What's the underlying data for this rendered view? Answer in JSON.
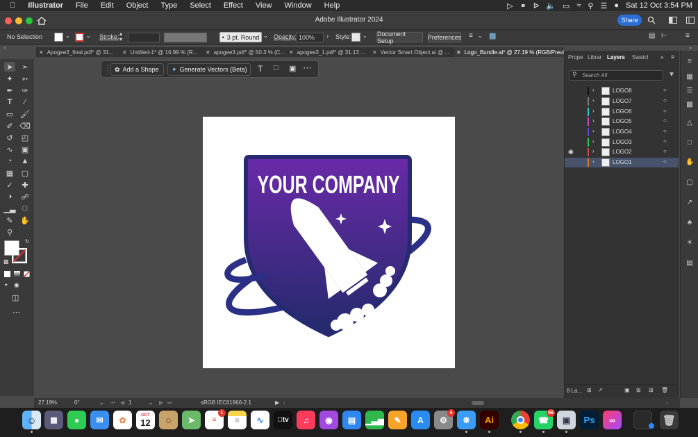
{
  "menubar": {
    "app_name": "Illustrator",
    "items": [
      "File",
      "Edit",
      "Object",
      "Type",
      "Select",
      "Effect",
      "View",
      "Window",
      "Help"
    ],
    "datetime": "Sat 12 Oct  3:54 PM"
  },
  "titlebar": {
    "title": "Adobe Illustrator 2024",
    "share_label": "Share"
  },
  "control_bar": {
    "selection": "No Selection",
    "stroke_label": "Stroke:",
    "brush": "3 pt. Round",
    "opacity_label": "Opacity:",
    "opacity_value": "100%",
    "style_label": "Style:",
    "document_setup": "Document Setup",
    "preferences": "Preferences"
  },
  "tabs": [
    "Apogee3_final.pdf* @ 31...",
    "Untitled-1* @ 16.99 % (R...",
    "apogee3.pdf* @ 50.3 % (C...",
    "apogee3_1.pdf* @ 31.13 ...",
    "Vector Smart Object.ai @ ...",
    "Logo_Bundle.ai* @ 27.19 % (RGB/Previe"
  ],
  "context_bar": {
    "add_shape": "Add a Shape",
    "generate_vectors": "Generate Vectors (Beta)"
  },
  "logo": {
    "text": "YOUR COMPANY",
    "color_top": "#6a2aa8",
    "color_bottom": "#232a6b",
    "ring_color": "#2b2f86"
  },
  "panel": {
    "tabs": [
      "Prope",
      "Librar",
      "Layers",
      "Swatcl"
    ],
    "search_placeholder": "Search All",
    "layers": [
      "LOGO8",
      "LOGO7",
      "LOGO6",
      "LOGO5",
      "LOGO4",
      "LOGO3",
      "LOGO2",
      "LOGO1"
    ],
    "layer_colors": [
      "#111111",
      "#7a7a7a",
      "#3fc6c6",
      "#c64fc6",
      "#5a4fc6",
      "#3fc64f",
      "#c64f4f",
      "#e07a2a"
    ],
    "footer_count": "8 La..."
  },
  "status": {
    "zoom": "27.19%",
    "rotation": "0°",
    "artboard": "1",
    "profile": "sRGB IEC61966-2.1"
  },
  "dock": {
    "calendar_month": "OCT",
    "calendar_day": "12",
    "badges": {
      "settings": "4",
      "whatsapp": "66",
      "reminders": "1"
    },
    "illustrator_label": "Ai",
    "photoshop_label": "Ps",
    "appletv_label": "tv"
  }
}
